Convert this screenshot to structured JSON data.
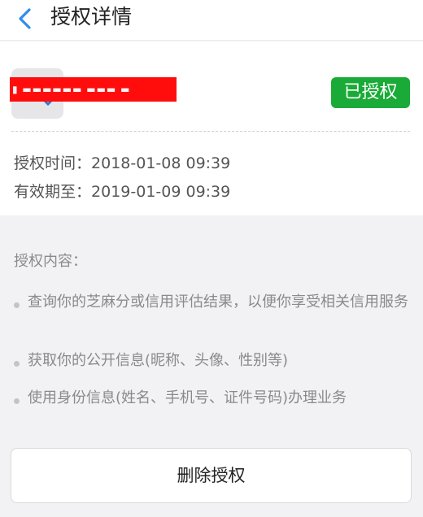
{
  "header": {
    "title": "授权详情",
    "back_icon": "chevron-left-icon",
    "accent_color": "#2f8ee8"
  },
  "app": {
    "name": "▮ ▬▬▬▬▬▬ ▬▬▬ ▬",
    "icon": "app-icon",
    "redaction_color": "#ff0d0d"
  },
  "authorization": {
    "status": "已授权",
    "status_color": "#1aaa37",
    "auth_time_label": "授权时间：",
    "auth_time": "2018-01-08 09:39",
    "valid_until_label": "有效期至：",
    "valid_until": "2019-01-09 09:39"
  },
  "content": {
    "title": "授权内容：",
    "items": [
      "查询你的芝麻分或信用评估结果，以便你享受相关信用服务",
      "获取你的公开信息(昵称、头像、性别等)",
      "使用身份信息(姓名、手机号、证件号码)办理业务"
    ]
  },
  "actions": {
    "delete_label": "删除授权"
  }
}
